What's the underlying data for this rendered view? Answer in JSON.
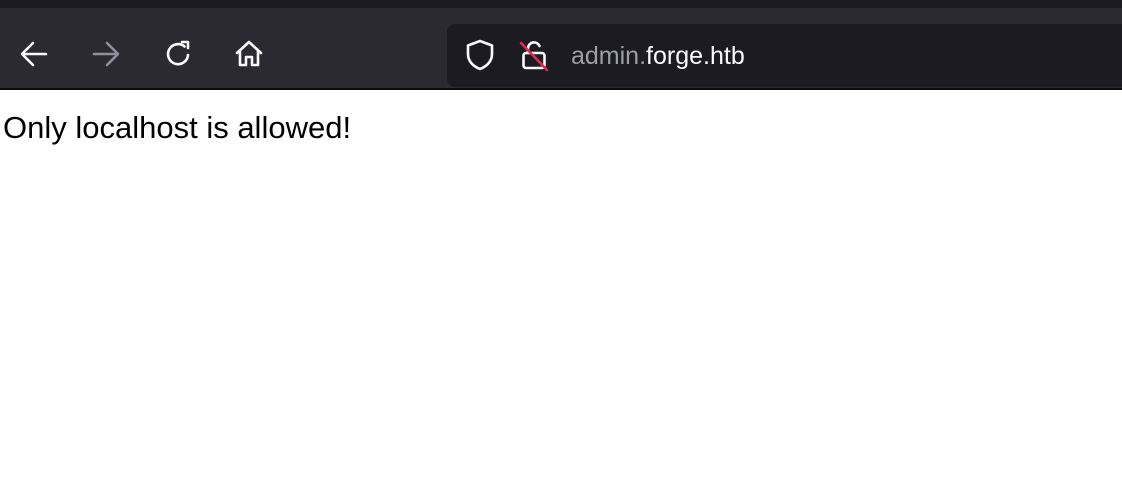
{
  "toolbar": {
    "back_icon": "arrow-left-icon",
    "forward_icon": "arrow-right-icon",
    "reload_icon": "reload-icon",
    "home_icon": "home-icon"
  },
  "urlbar": {
    "tracking_icon": "shield-icon",
    "security_icon": "insecure-lock-icon",
    "subdomain": "admin.",
    "domain": "forge.htb"
  },
  "page": {
    "message": "Only localhost is allowed!"
  },
  "colors": {
    "toolbar_bg": "#2b2a33",
    "urlbar_bg": "#1c1b22",
    "insecure_strike": "#e22850"
  }
}
